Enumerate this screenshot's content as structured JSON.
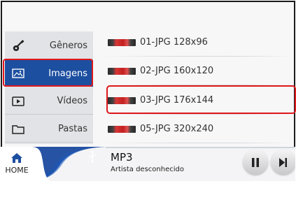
{
  "sidebar": {
    "items": [
      {
        "label": "Gêneros",
        "icon": "guitar-icon",
        "selected": false
      },
      {
        "label": "Imagens",
        "icon": "picture-icon",
        "selected": true
      },
      {
        "label": "Vídeos",
        "icon": "play-icon",
        "selected": false
      },
      {
        "label": "Pastas",
        "icon": "folder-icon",
        "selected": false
      }
    ]
  },
  "files": [
    {
      "name": "01-JPG 128x96",
      "selected": false
    },
    {
      "name": "02-JPG 160x120",
      "selected": false
    },
    {
      "name": "03-JPG 176x144",
      "selected": true
    },
    {
      "name": "05-JPG 320x240",
      "selected": false
    }
  ],
  "player": {
    "home_label": "HOME",
    "title": "MP3",
    "artist": "Artista desconhecido",
    "source_icon": "usb-icon",
    "controls": [
      "pause-icon",
      "next-track-icon"
    ]
  },
  "colors": {
    "accent_blue": "#1d4fa0",
    "highlight_red": "#e0171b"
  }
}
